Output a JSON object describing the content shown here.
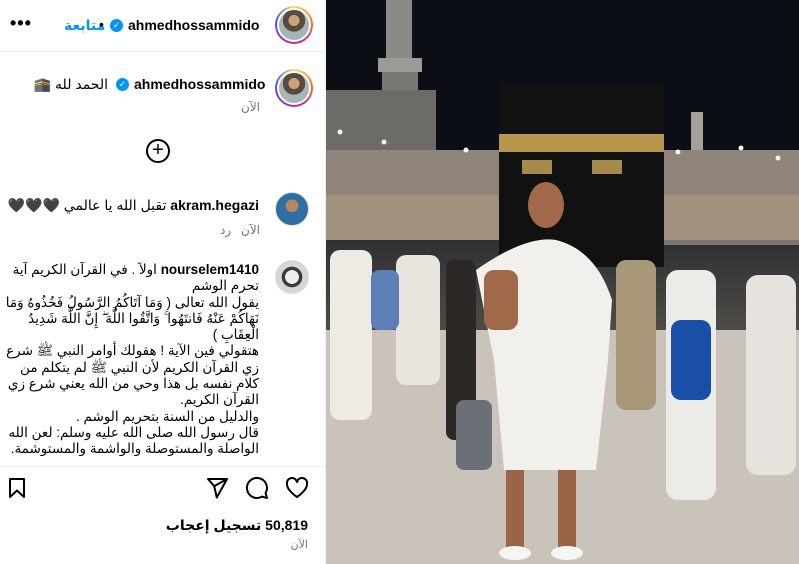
{
  "header": {
    "username": "ahmedhossammido",
    "verified_mark": "✓",
    "separator": "•",
    "follow_label": "متابعة",
    "more_label": "•••"
  },
  "caption": {
    "username": "ahmedhossammido",
    "text": "الحمد لله 🕋",
    "time": "الآن"
  },
  "comments": [
    {
      "username": "akram.hegazi",
      "text": "تقبل الله يا عالمي 🖤🖤🖤",
      "time": "الآن",
      "reply_label": "رد"
    },
    {
      "username": "nourselem1410",
      "lines": [
        "اولاً . في القرآن الكريم آية تحرم الوشم",
        "يقول الله تعالى ( وَمَا آتَاكُمُ الرَّسُولُ فَخُذُوهُ وَمَا نَهَاكُمْ عَنْهُ فَانتَهُوا ۚ وَاتَّقُوا اللَّهَ ۖ إِنَّ اللَّهَ شَدِيدُ الْعِقَابِ )",
        "هتقولي فين الآية ! هقولك أوامر النبي ﷺ شرع زي القرآن الكريم لأن النبي ﷺ لم يتكلم من كلام نفسه بل هذا وحي من الله يعني شرع زي القرآن الكريم.",
        "والدليل من السنة بتحريم الوشم .",
        "قال رسول الله صلى الله عليه وسلم: لعن الله الواصلة والمستوصلة والواشمة والمستوشمة. رواه"
      ]
    }
  ],
  "likes": {
    "count": "50,819",
    "label": "تسجيل إعجاب"
  },
  "post_time": "الآن",
  "icons": [
    "more-icon",
    "verified-icon",
    "add-comment-icon",
    "share-icon",
    "comment-icon",
    "like-icon",
    "save-icon"
  ],
  "colors": {
    "accent": "#0095f6",
    "muted": "#737373",
    "border": "#efefef"
  }
}
